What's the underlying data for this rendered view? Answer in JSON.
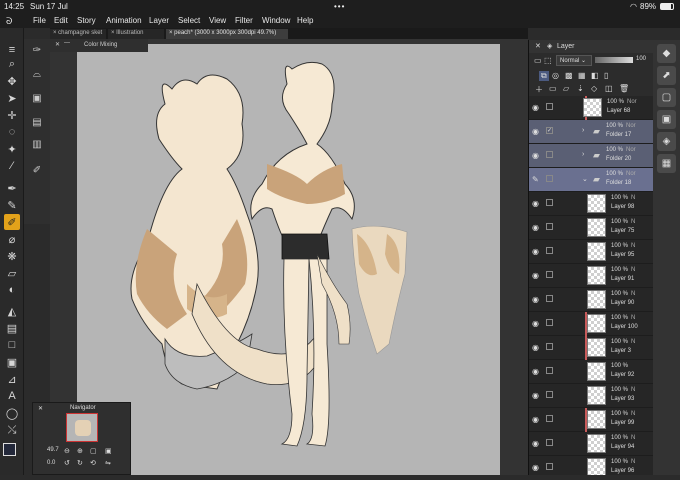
{
  "status": {
    "time": "14:25",
    "date": "Sun 17 Jul",
    "dots": "•••",
    "battery": "89%"
  },
  "menu": [
    "File",
    "Edit",
    "Story",
    "Animation",
    "Layer",
    "Select",
    "View",
    "Filter",
    "Window",
    "Help"
  ],
  "tabs": [
    {
      "label": "champagne sket"
    },
    {
      "label": "Illustration"
    },
    {
      "label": "peach* (3000 x 3000px 300dpi 49.7%)"
    }
  ],
  "color_panel": {
    "title": "Color Mixing",
    "collapse": "—"
  },
  "navigator": {
    "title": "Navigator",
    "zoom": "49.7",
    "angle": "0.0"
  },
  "layer_panel": {
    "title": "Layer",
    "blend_mode": "Normal",
    "opacity_value": "100",
    "rows": [
      {
        "pct": "100 %",
        "mode": "Nor",
        "name": "Layer 68",
        "type": "layer",
        "checked": false,
        "red": true
      },
      {
        "pct": "100 %",
        "mode": "Nor",
        "name": "Folder 17",
        "type": "folder",
        "checked": true,
        "selected": false,
        "expand": "›"
      },
      {
        "pct": "100 %",
        "mode": "Nor",
        "name": "Folder 20",
        "type": "folder",
        "checked": false,
        "selected": false,
        "expand": "›"
      },
      {
        "pct": "100 %",
        "mode": "Nor",
        "name": "Folder 18",
        "type": "folder",
        "checked": false,
        "selected": true,
        "expand": "⌄",
        "pen": true
      },
      {
        "pct": "100 %",
        "mode": "N",
        "name": "Layer 98",
        "type": "layer"
      },
      {
        "pct": "100 %",
        "mode": "N",
        "name": "Layer 75",
        "type": "layer"
      },
      {
        "pct": "100 %",
        "mode": "N",
        "name": "Layer 95",
        "type": "layer"
      },
      {
        "pct": "100 %",
        "mode": "N",
        "name": "Layer 91",
        "type": "layer"
      },
      {
        "pct": "100 %",
        "mode": "N",
        "name": "Layer 90",
        "type": "layer"
      },
      {
        "pct": "100 %",
        "mode": "N",
        "name": "Layer 100",
        "type": "layer",
        "red": true
      },
      {
        "pct": "100 %",
        "mode": "N",
        "name": "Layer 3",
        "type": "layer",
        "red": true
      },
      {
        "pct": "100 %",
        "mode": "",
        "name": "Layer 92",
        "type": "layer"
      },
      {
        "pct": "100 %",
        "mode": "N",
        "name": "Layer 93",
        "type": "layer"
      },
      {
        "pct": "100 %",
        "mode": "N",
        "name": "Layer 99",
        "type": "layer",
        "red": true
      },
      {
        "pct": "100 %",
        "mode": "N",
        "name": "Layer 94",
        "type": "layer"
      },
      {
        "pct": "100 %",
        "mode": "N",
        "name": "Layer 96",
        "type": "layer"
      }
    ]
  },
  "colors": {
    "accent": "#e3a21a",
    "folder": "#5a5f74",
    "folder_selected": "#6a7090",
    "paper": "#b5b5b5"
  }
}
